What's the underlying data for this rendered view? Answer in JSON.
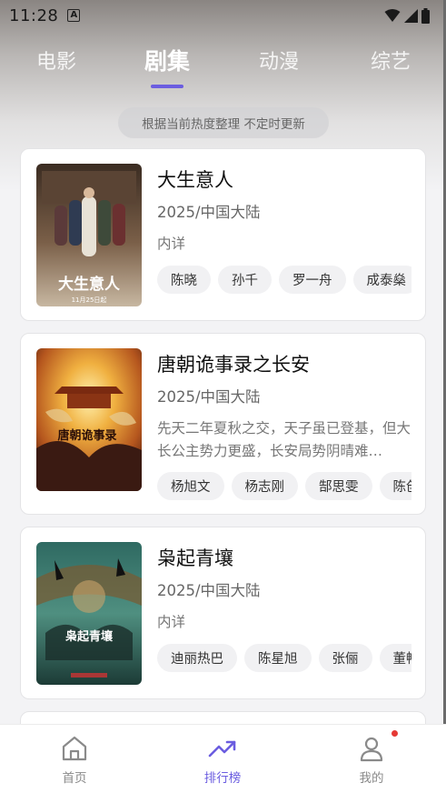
{
  "status_bar": {
    "time": "11:28"
  },
  "tabs": [
    {
      "label": "电影",
      "active": false
    },
    {
      "label": "剧集",
      "active": true
    },
    {
      "label": "动漫",
      "active": false
    },
    {
      "label": "综艺",
      "active": false
    }
  ],
  "notice": "根据当前热度整理 不定时更新",
  "items": [
    {
      "title": "大生意人",
      "meta": "2025/中国大陆",
      "desc": "内详",
      "cast": [
        "陈晓",
        "孙千",
        "罗一舟",
        "成泰燊"
      ],
      "poster_text": "大生意人",
      "poster_sub": "11月25日起"
    },
    {
      "title": "唐朝诡事录之长安",
      "meta": "2025/中国大陆",
      "desc": "先天二年夏秋之交，天子虽已登基，但大长公主势力更盛，长安局势阴晴难…",
      "cast": [
        "杨旭文",
        "杨志刚",
        "郜思雯",
        "陈创"
      ],
      "poster_text": "唐朝诡事录"
    },
    {
      "title": "枭起青壤",
      "meta": "2025/中国大陆",
      "desc": "内详",
      "cast": [
        "迪丽热巴",
        "陈星旭",
        "张俪",
        "董畅"
      ],
      "poster_text": "枭起青壤"
    }
  ],
  "bottom_nav": [
    {
      "label": "首页",
      "icon": "home-icon",
      "active": false
    },
    {
      "label": "排行榜",
      "icon": "trending-icon",
      "active": true
    },
    {
      "label": "我的",
      "icon": "user-icon",
      "active": false,
      "badge": true
    }
  ],
  "colors": {
    "accent": "#6b5de0",
    "badge": "#e53935"
  }
}
